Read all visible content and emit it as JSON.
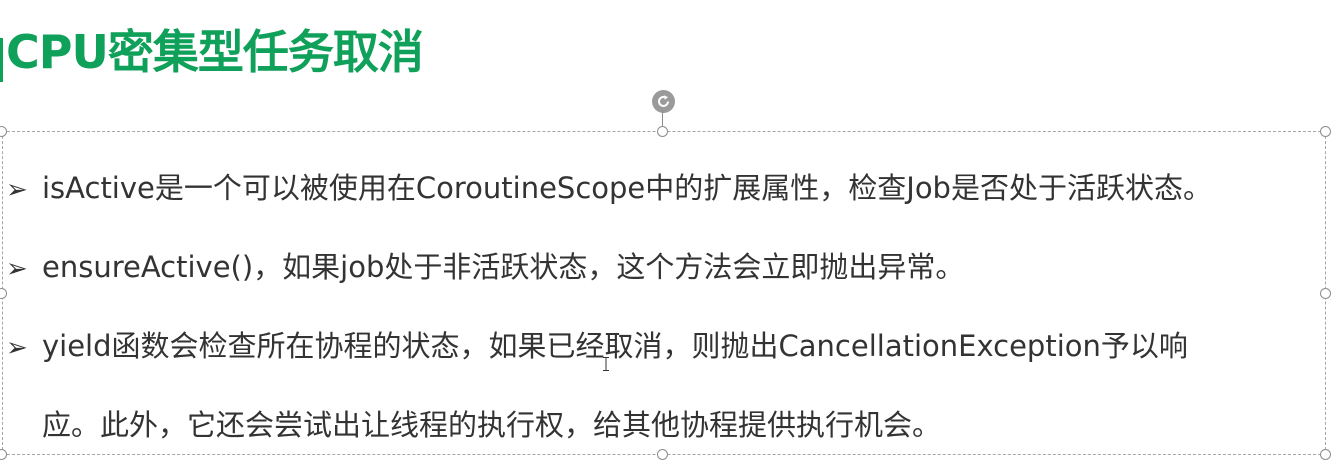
{
  "slide": {
    "title": "CPU密集型任务取消",
    "bullets": [
      {
        "marker": "➢",
        "text": "isActive是一个可以被使用在CoroutineScope中的扩展属性，检查Job是否处于活跃状态。"
      },
      {
        "marker": "➢",
        "text": "ensureActive()，如果job处于非活跃状态，这个方法会立即抛出异常。"
      },
      {
        "marker": "➢",
        "text": "yield函数会检查所在协程的状态，如果已经取消，则抛出CancellationException予以响",
        "continuation": "应。此外，它还会尝试出让线程的执行权，给其他协程提供执行机会。"
      }
    ]
  },
  "colors": {
    "title": "#0fa05a",
    "body_text": "#333333",
    "selection_border": "#a6a6a6"
  },
  "icons": {
    "rotate": "rotate-handle-icon",
    "bullet": "arrow-bullet-icon",
    "cursor": "text-cursor-icon"
  }
}
